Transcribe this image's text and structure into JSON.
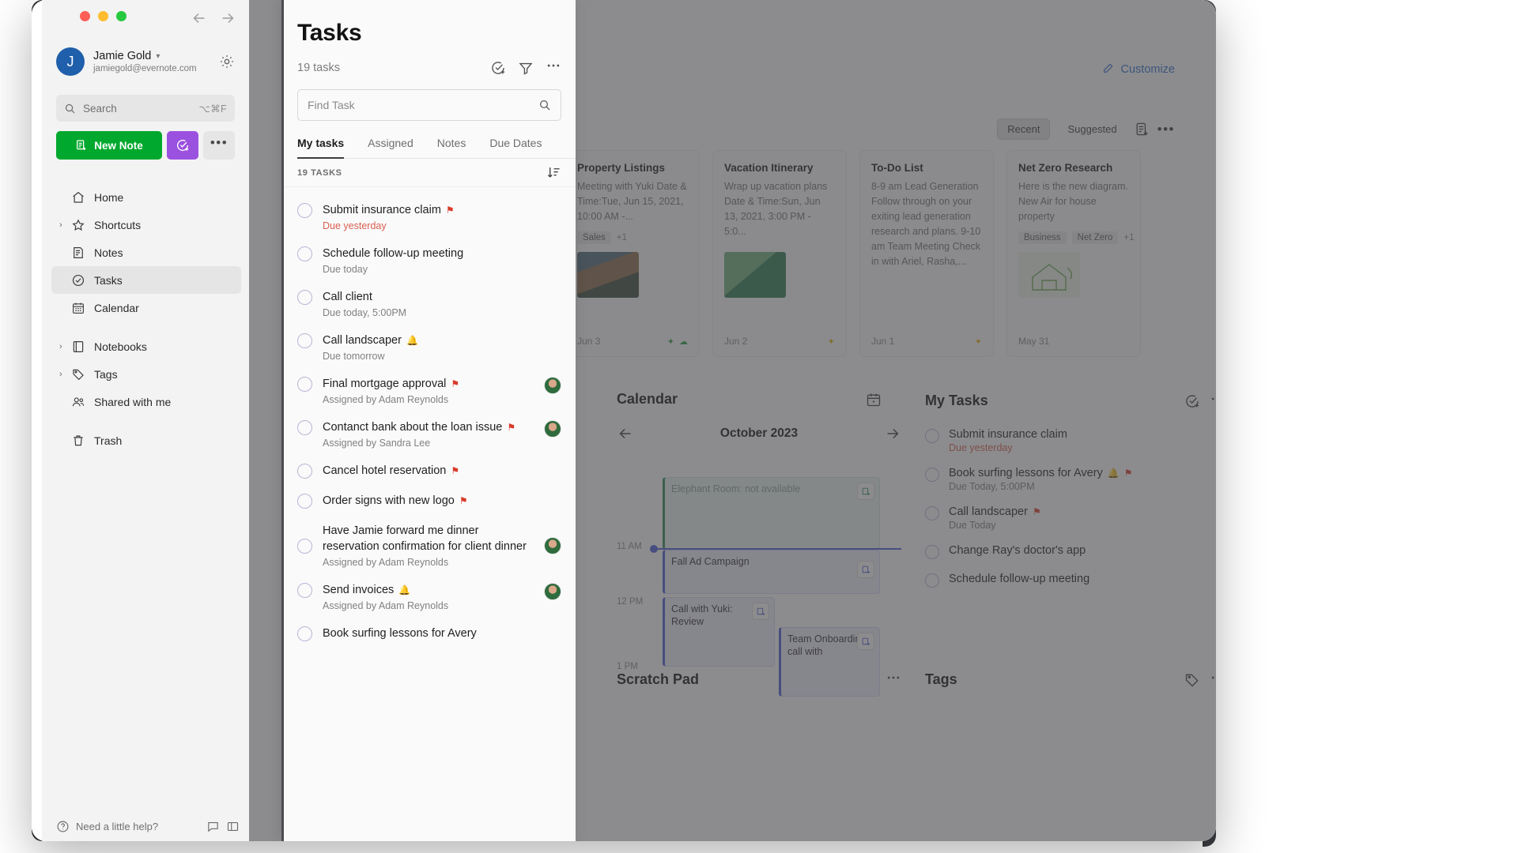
{
  "window": {
    "traffic_lights": [
      "close",
      "minimize",
      "maximize"
    ],
    "back_label": "Back",
    "forward_label": "Forward"
  },
  "account": {
    "avatar_initial": "J",
    "name": "Jamie Gold",
    "email": "jamiegold@evernote.com",
    "caret": "⌄",
    "settings_icon": "gear-icon"
  },
  "search": {
    "placeholder": "Search",
    "shortcut": "⌥⌘F"
  },
  "actions": {
    "new_note_label": "New Note",
    "new_task_label": "",
    "more_label": "•••"
  },
  "sidebar": {
    "items": [
      {
        "label": "Home",
        "icon": "home-icon",
        "expandable": false,
        "active": false
      },
      {
        "label": "Shortcuts",
        "icon": "star-icon",
        "expandable": true,
        "active": false
      },
      {
        "label": "Notes",
        "icon": "note-icon",
        "expandable": false,
        "active": false
      },
      {
        "label": "Tasks",
        "icon": "task-check-icon",
        "expandable": false,
        "active": true
      },
      {
        "label": "Calendar",
        "icon": "calendar-icon",
        "expandable": false,
        "active": false
      },
      {
        "label": "Notebooks",
        "icon": "notebook-icon",
        "expandable": true,
        "active": false
      },
      {
        "label": "Tags",
        "icon": "tag-icon",
        "expandable": true,
        "active": false
      },
      {
        "label": "Shared with me",
        "icon": "people-icon",
        "expandable": false,
        "active": false
      },
      {
        "label": "Trash",
        "icon": "trash-icon",
        "expandable": false,
        "active": false
      }
    ],
    "bottom_label": "Need a little help?"
  },
  "tasks_panel": {
    "title": "Tasks",
    "count_label": "19 tasks",
    "header_icons": [
      "add-task-icon",
      "filter-icon",
      "more-icon"
    ],
    "find_placeholder": "Find Task",
    "find_icon": "search-icon",
    "tabs": [
      {
        "label": "My tasks",
        "active": true
      },
      {
        "label": "Assigned",
        "active": false
      },
      {
        "label": "Notes",
        "active": false
      },
      {
        "label": "Due Dates",
        "active": false
      }
    ],
    "list_header": "19 TASKS",
    "sort_icon": "sort-descending-icon",
    "tasks": [
      {
        "title": "Submit insurance claim",
        "flag": true,
        "bell": false,
        "sub": "Due yesterday",
        "overdue": true,
        "assignee": false
      },
      {
        "title": "Schedule follow-up meeting",
        "flag": false,
        "bell": false,
        "sub": "Due today",
        "overdue": false,
        "assignee": false
      },
      {
        "title": "Call client",
        "flag": false,
        "bell": false,
        "sub": "Due today, 5:00PM",
        "overdue": false,
        "assignee": false
      },
      {
        "title": "Call landscaper",
        "flag": false,
        "bell": true,
        "sub": "Due tomorrow",
        "overdue": false,
        "assignee": false
      },
      {
        "title": "Final mortgage approval",
        "flag": true,
        "bell": false,
        "sub": "Assigned by Adam Reynolds",
        "overdue": false,
        "assignee": true
      },
      {
        "title": "Contanct bank about the loan issue",
        "flag": true,
        "bell": false,
        "sub": "Assigned by Sandra Lee",
        "overdue": false,
        "assignee": true
      },
      {
        "title": "Cancel hotel reservation",
        "flag": true,
        "bell": false,
        "sub": "",
        "overdue": false,
        "assignee": false
      },
      {
        "title": "Order signs with new logo",
        "flag": true,
        "bell": false,
        "sub": "",
        "overdue": false,
        "assignee": false
      },
      {
        "title": "Have Jamie forward me dinner reservation confirmation for client dinner",
        "flag": false,
        "bell": false,
        "sub": "Assigned by Adam Reynolds",
        "overdue": false,
        "assignee": true
      },
      {
        "title": "Send invoices",
        "flag": false,
        "bell": true,
        "sub": "Assigned by Adam Reynolds",
        "overdue": false,
        "assignee": true
      },
      {
        "title": "Book surfing lessons for Avery",
        "flag": false,
        "bell": false,
        "sub": "",
        "overdue": false,
        "assignee": false
      }
    ]
  },
  "background": {
    "customize_label": "Customize",
    "customize_icon": "pencil-icon",
    "notes_toolbar": {
      "recent_label": "Recent",
      "suggested_label": "Suggested",
      "note_icon": "new-note-icon",
      "more": "•••"
    },
    "note_cards": [
      {
        "title": "Property Listings",
        "text": "Meeting with Yuki Date & Time:Tue, Jun 15, 2021, 10:00 AM -...",
        "tags": [
          "Sales"
        ],
        "tag_plus": "+1",
        "thumb": "thumb-house",
        "date": "Jun 3",
        "foot_icons": [
          "leaf-icon",
          "people-icon"
        ]
      },
      {
        "title": "Vacation Itinerary",
        "text": "Wrap up vacation plans Date & Time:Sun, Jun 13, 2021, 3:00 PM - 5:0...",
        "tags": [],
        "tag_plus": "",
        "thumb": "thumb-map",
        "date": "Jun 2",
        "foot_icons": [
          "star-icon"
        ]
      },
      {
        "title": "To-Do List",
        "text": "8-9 am Lead Generation Follow through on your exiting lead generation research and plans. 9-10 am Team Meeting Check in with Ariel, Rasha,...",
        "tags": [],
        "tag_plus": "",
        "thumb": "",
        "date": "Jun 1",
        "foot_icons": [
          "star-icon"
        ]
      },
      {
        "title": "Net Zero Research",
        "text": "Here is the new diagram. New Air for house property",
        "tags": [
          "Business",
          "Net Zero"
        ],
        "tag_plus": "+1",
        "thumb": "thumb-eco",
        "date": "May 31",
        "foot_icons": []
      }
    ],
    "calendar": {
      "title": "Calendar",
      "header_icons": [
        "calendar-add-icon",
        "more-icon"
      ],
      "month": "October 2023",
      "prev_icon": "arrow-left-icon",
      "next_icon": "arrow-right-icon",
      "times": [
        "11 AM",
        "12 PM",
        "1 PM"
      ],
      "events": [
        {
          "title": "Elephant Room: not available",
          "style": "green"
        },
        {
          "title": "Fall Ad Campaign",
          "style": "blue"
        },
        {
          "title": "Call with Yuki: Review",
          "style": "blue"
        },
        {
          "title": "Team Onboarding call with",
          "style": "blue"
        }
      ]
    },
    "mytasks": {
      "title": "My Tasks",
      "header_icons": [
        "add-task-icon",
        "more-icon"
      ],
      "items": [
        {
          "title": "Submit insurance claim",
          "flag": false,
          "bell": false,
          "sub": "Due yesterday",
          "overdue": true
        },
        {
          "title": "Book surfing lessons for Avery",
          "flag": true,
          "bell": true,
          "sub": "Due Today, 5:00PM",
          "overdue": false
        },
        {
          "title": "Call landscaper",
          "flag": true,
          "bell": false,
          "sub": "Due Today",
          "overdue": false
        },
        {
          "title": "Change Ray's doctor's app",
          "flag": false,
          "bell": false,
          "sub": "",
          "overdue": false
        },
        {
          "title": "Schedule follow-up meeting",
          "flag": false,
          "bell": false,
          "sub": "",
          "overdue": false
        }
      ]
    },
    "scratch_pad": {
      "title": "Scratch Pad",
      "more": "•••"
    },
    "tags_widget": {
      "title": "Tags",
      "icons": [
        "tag-add-icon",
        "more-icon"
      ]
    }
  },
  "colors": {
    "brand_green": "#00a82d",
    "task_purple": "#9b51e0",
    "accent_blue": "#2f6fd0",
    "overdue_red": "#d9604f",
    "flag_red": "#d93a2b",
    "bell_blue": "#3b5bdb"
  }
}
